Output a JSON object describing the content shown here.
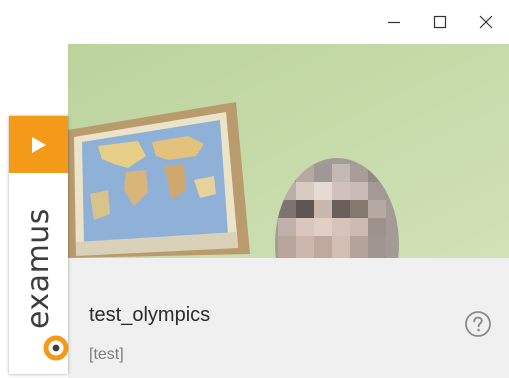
{
  "window": {
    "minimize_icon": "minimize-icon",
    "maximize_icon": "maximize-icon",
    "close_icon": "close-icon"
  },
  "brand": {
    "name": "examus",
    "accent_color": "#f39a19",
    "play_icon": "play-icon",
    "logo_icon": "examus-logo-icon"
  },
  "camera": {
    "content": "webcam-feed"
  },
  "session": {
    "name": "test_olympics",
    "tag": "[test]",
    "help_icon": "question-circle-icon"
  }
}
